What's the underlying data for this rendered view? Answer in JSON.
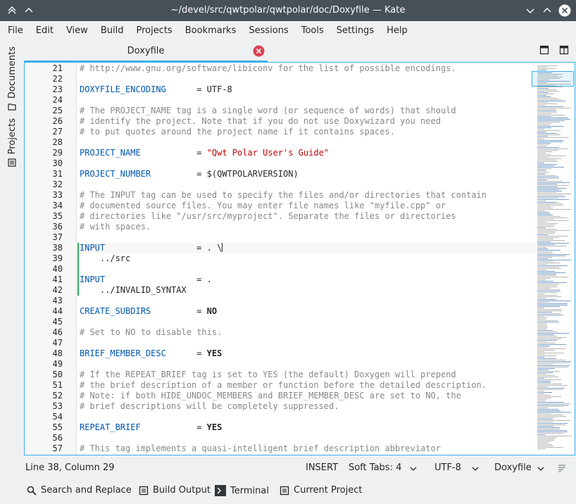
{
  "window": {
    "title": "~/devel/src/qwtpolar/qwtpolar/doc/Doxyfile — Kate"
  },
  "menu": [
    "File",
    "Edit",
    "View",
    "Build",
    "Projects",
    "Bookmarks",
    "Sessions",
    "Tools",
    "Settings",
    "Help"
  ],
  "sidebar": {
    "documents": "Documents",
    "projects": "Projects"
  },
  "tab": {
    "label": "Doxyfile"
  },
  "editor": {
    "lines": [
      {
        "n": "21",
        "text": "# http://www.gnu.org/software/libiconv for the list of possible encodings."
      },
      {
        "n": "22",
        "text": ""
      },
      {
        "n": "23",
        "key": "DOXYFILE_ENCODING",
        "op": "= ",
        "val": "UTF-8",
        "vtype": "plain"
      },
      {
        "n": "24",
        "text": ""
      },
      {
        "n": "25",
        "text": "# The PROJECT_NAME tag is a single word (or sequence of words) that should"
      },
      {
        "n": "26",
        "text": "# identify the project. Note that if you do not use Doxywizard you need"
      },
      {
        "n": "27",
        "text": "# to put quotes around the project name if it contains spaces."
      },
      {
        "n": "28",
        "text": ""
      },
      {
        "n": "29",
        "key": "PROJECT_NAME",
        "op": "= ",
        "val": "\"Qwt Polar User's Guide\"",
        "vtype": "str"
      },
      {
        "n": "30",
        "text": ""
      },
      {
        "n": "31",
        "key": "PROJECT_NUMBER",
        "op": "= ",
        "val": "$(QWTPOLARVERSION)",
        "vtype": "plain"
      },
      {
        "n": "32",
        "text": ""
      },
      {
        "n": "33",
        "text": "# The INPUT tag can be used to specify the files and/or directories that contain"
      },
      {
        "n": "34",
        "text": "# documented source files. You may enter file names like \"myfile.cpp\" or"
      },
      {
        "n": "35",
        "text": "# directories like \"/usr/src/myproject\". Separate the files or directories"
      },
      {
        "n": "36",
        "text": "# with spaces."
      },
      {
        "n": "37",
        "text": ""
      },
      {
        "n": "38",
        "key": "INPUT",
        "op": "= ",
        "val": ". \\",
        "vtype": "plain",
        "current": true,
        "modified": true
      },
      {
        "n": "39",
        "plain": "    ../src",
        "modified": true
      },
      {
        "n": "40",
        "text": "",
        "modified": true
      },
      {
        "n": "41",
        "key": "INPUT",
        "op": "= ",
        "val": ".",
        "vtype": "plain",
        "modified": true
      },
      {
        "n": "42",
        "plain": "    ../INVALID_SYNTAX",
        "modified": true
      },
      {
        "n": "43",
        "text": ""
      },
      {
        "n": "44",
        "key": "CREATE_SUBDIRS",
        "op": "= ",
        "val": "NO",
        "vtype": "bold"
      },
      {
        "n": "45",
        "text": ""
      },
      {
        "n": "46",
        "text": "# Set to NO to disable this."
      },
      {
        "n": "47",
        "text": ""
      },
      {
        "n": "48",
        "key": "BRIEF_MEMBER_DESC",
        "op": "= ",
        "val": "YES",
        "vtype": "bold"
      },
      {
        "n": "49",
        "text": ""
      },
      {
        "n": "50",
        "text": "# If the REPEAT_BRIEF tag is set to YES (the default) Doxygen will prepend"
      },
      {
        "n": "51",
        "text": "# the brief description of a member or function before the detailed description."
      },
      {
        "n": "52",
        "text": "# Note: if both HIDE_UNDOC_MEMBERS and BRIEF_MEMBER_DESC are set to NO, the"
      },
      {
        "n": "53",
        "text": "# brief descriptions will be completely suppressed."
      },
      {
        "n": "54",
        "text": ""
      },
      {
        "n": "55",
        "key": "REPEAT_BRIEF",
        "op": "= ",
        "val": "YES",
        "vtype": "bold"
      },
      {
        "n": "56",
        "text": ""
      },
      {
        "n": "57",
        "text": "# This tag implements a quasi-intelligent brief description abbreviator"
      }
    ]
  },
  "status": {
    "position": "Line 38, Column 29",
    "mode": "INSERT",
    "indent": "Soft Tabs: 4",
    "encoding": "UTF-8",
    "syntax": "Doxyfile"
  },
  "bottom": {
    "search": "Search and Replace",
    "build": "Build Output",
    "terminal": "Terminal",
    "project": "Current Project"
  },
  "colors": {
    "accent": "#3daee9",
    "titlebar": "#475057",
    "close": "#da4453",
    "modified": "#27ae60"
  }
}
